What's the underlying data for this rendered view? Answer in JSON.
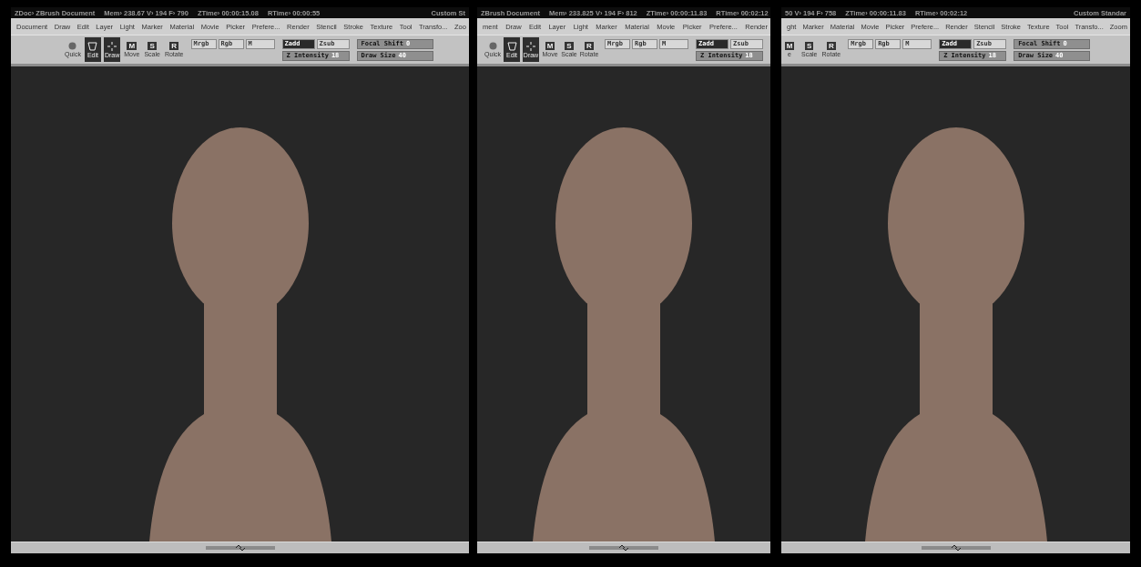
{
  "panels": [
    {
      "title_bar": {
        "items": [
          "ZDoc› ZBrush Document",
          "Mem› 238.67 V› 194 F› 790",
          "ZTime› 00:00:15.08",
          "RTime› 00:00:55"
        ],
        "right": "Custom St"
      },
      "menu": [
        "Document",
        "Draw",
        "Edit",
        "Layer",
        "Light",
        "Marker",
        "Material",
        "Movie",
        "Picker",
        "Prefere...",
        "Render",
        "Stencil",
        "Stroke",
        "Texture",
        "Tool",
        "Transfo...",
        "Zoo"
      ],
      "toolbar": {
        "tools": [
          {
            "kind": "quick",
            "label": "Quick",
            "selected": false
          },
          {
            "kind": "edit",
            "label": "Edit",
            "selected": true
          },
          {
            "kind": "draw",
            "label": "Draw",
            "selected": true
          },
          {
            "kind": "lettered",
            "key": "M",
            "label": "Move",
            "selected": false
          },
          {
            "kind": "lettered",
            "key": "S",
            "label": "Scale",
            "selected": false
          },
          {
            "kind": "lettered",
            "key": "R",
            "label": "Rotate",
            "selected": false
          }
        ],
        "channels": [
          {
            "label": "Mrgb",
            "selected": false
          },
          {
            "label": "Rgb",
            "selected": false
          },
          {
            "label": "M",
            "selected": false
          },
          {
            "label": "Zadd",
            "selected": true
          },
          {
            "label": "Zsub",
            "selected": false
          }
        ],
        "channel_sliders": [
          {
            "label": "Z Intensity",
            "value": "18"
          }
        ],
        "side_sliders": [
          {
            "label": "Focal Shift",
            "value": "0"
          },
          {
            "label": "Draw Size",
            "value": "40"
          }
        ]
      }
    },
    {
      "title_bar": {
        "items": [
          "ZBrush Document",
          "Mem› 233.825 V› 194 F› 812",
          "ZTime› 00:00:11.83",
          "RTime› 00:02:12"
        ]
      },
      "menu": [
        "ment",
        "Draw",
        "Edit",
        "Layer",
        "Light",
        "Marker",
        "Material",
        "Movie",
        "Picker",
        "Prefere...",
        "Render"
      ],
      "toolbar": {
        "tools": [
          {
            "kind": "quick",
            "label": "Quick",
            "selected": false
          },
          {
            "kind": "edit",
            "label": "Edit",
            "selected": true
          },
          {
            "kind": "draw",
            "label": "Draw",
            "selected": true
          },
          {
            "kind": "lettered",
            "key": "M",
            "label": "Move",
            "selected": false
          },
          {
            "kind": "lettered",
            "key": "S",
            "label": "Scale",
            "selected": false
          },
          {
            "kind": "lettered",
            "key": "R",
            "label": "Rotate",
            "selected": false
          }
        ],
        "channels": [
          {
            "label": "Mrgb",
            "selected": false
          },
          {
            "label": "Rgb",
            "selected": false
          },
          {
            "label": "M",
            "selected": false
          },
          {
            "label": "Zadd",
            "selected": true
          },
          {
            "label": "Zsub",
            "selected": false
          }
        ],
        "channel_sliders": [
          {
            "label": "Z Intensity",
            "value": "18"
          }
        ]
      }
    },
    {
      "title_bar": {
        "items": [
          "50 V› 194 F› 758",
          "ZTime› 00:00:11.83",
          "RTime› 00:02:12"
        ],
        "right": "Custom Standar"
      },
      "menu": [
        "ght",
        "Marker",
        "Material",
        "Movie",
        "Picker",
        "Prefere...",
        "Render",
        "Stencil",
        "Stroke",
        "Texture",
        "Tool",
        "Transfo...",
        "Zoom"
      ],
      "toolbar": {
        "tools": [
          {
            "kind": "lettered",
            "key": "M",
            "label": "e",
            "selected": false
          },
          {
            "kind": "lettered",
            "key": "S",
            "label": "Scale",
            "selected": false
          },
          {
            "kind": "lettered",
            "key": "R",
            "label": "Rotate",
            "selected": false
          }
        ],
        "channels": [
          {
            "label": "Mrgb",
            "selected": false
          },
          {
            "label": "Rgb",
            "selected": false
          },
          {
            "label": "M",
            "selected": false
          },
          {
            "label": "Zadd",
            "selected": true
          },
          {
            "label": "Zsub",
            "selected": false
          }
        ],
        "channel_sliders": [
          {
            "label": "Z Intensity",
            "value": "18"
          }
        ],
        "side_sliders": [
          {
            "label": "Focal Shift",
            "value": "0"
          },
          {
            "label": "Draw Size",
            "value": "40"
          }
        ]
      }
    }
  ]
}
